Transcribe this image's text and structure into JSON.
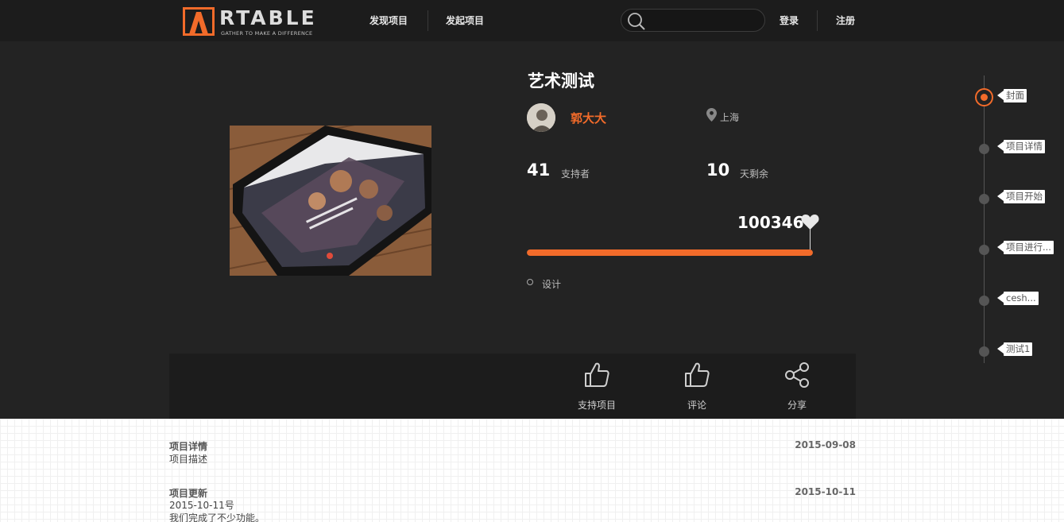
{
  "brand": {
    "wordmark": "RTABLE",
    "tagline": "GATHER TO MAKE A DIFFERENCE",
    "accent": "#f26b2a"
  },
  "nav": {
    "discover": "发现项目",
    "launch": "发起项目",
    "search_placeholder": "",
    "login": "登录",
    "register": "注册"
  },
  "project": {
    "title": "艺术测试",
    "author": "郭大大",
    "location": "上海",
    "supporters": "41",
    "supporters_label": "支持者",
    "days_left": "10",
    "days_left_label": "天剩余",
    "amount": "100346",
    "progress": 1.0,
    "tag": "设计"
  },
  "actions": [
    {
      "label": "支持项目",
      "icon": "thumbs-up-icon"
    },
    {
      "label": "评论",
      "icon": "thumbs-up-icon"
    },
    {
      "label": "分享",
      "icon": "share-icon"
    }
  ],
  "timeline": [
    {
      "label": "封面",
      "active": true
    },
    {
      "label": "项目详情",
      "active": false
    },
    {
      "label": "项目开始",
      "active": false
    },
    {
      "label": "项目进行...",
      "active": false
    },
    {
      "label": "cesh...",
      "active": false
    },
    {
      "label": "测试1",
      "active": false
    }
  ],
  "details": [
    {
      "heading": "项目详情",
      "date": "2015-09-08",
      "lines": [
        "项目描述"
      ]
    },
    {
      "heading": "项目更新",
      "date": "2015-10-11",
      "lines": [
        "2015-10-11号",
        "我们完成了不少功能。"
      ]
    }
  ]
}
